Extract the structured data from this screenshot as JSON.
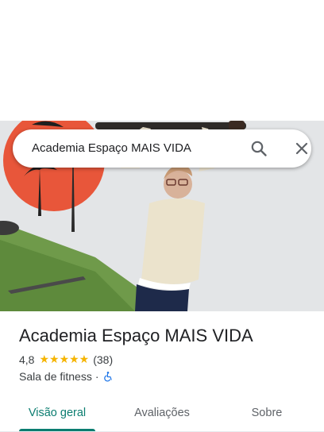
{
  "search": {
    "query": "Academia Espaço MAIS VIDA",
    "search_icon": "search-icon",
    "close_icon": "close-icon"
  },
  "photo": {
    "description_icon": "place-photo"
  },
  "place": {
    "title": "Academia Espaço MAIS VIDA",
    "rating": "4,8",
    "stars": "★★★★★",
    "review_count": "(38)",
    "category": "Sala de fitness",
    "separator": "·",
    "accessibility_icon": "wheelchair-icon"
  },
  "tabs": [
    {
      "label": "Visão geral",
      "active": true
    },
    {
      "label": "Avaliações",
      "active": false
    },
    {
      "label": "Sobre",
      "active": false
    }
  ],
  "colors": {
    "accent": "#0b7d70",
    "stars": "#f5b400",
    "accessibility": "#1a73e8"
  }
}
